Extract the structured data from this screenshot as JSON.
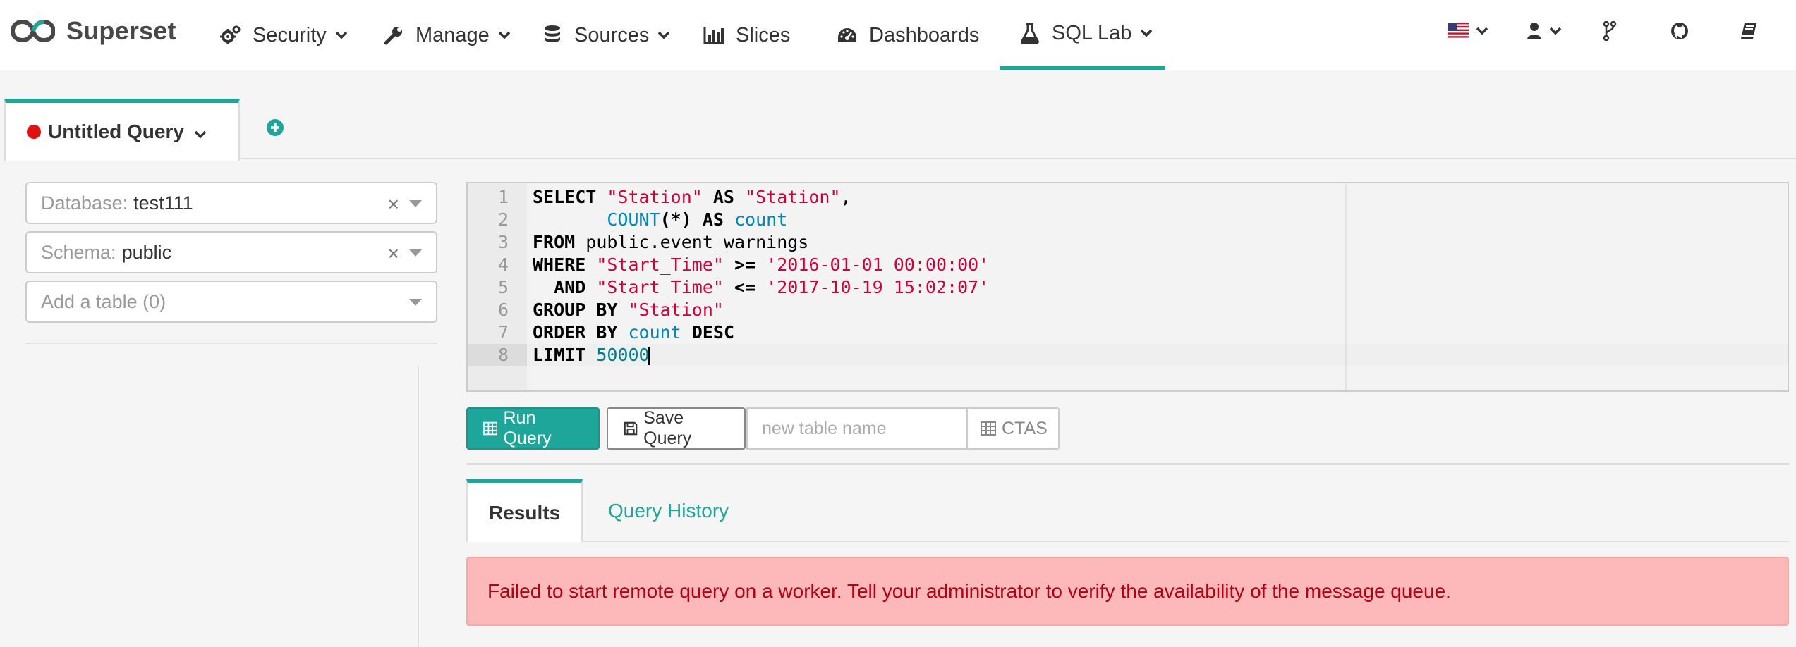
{
  "navbar": {
    "brand": "Superset",
    "items": [
      {
        "label": "Security",
        "icon": "cogs-icon",
        "dropdown": true
      },
      {
        "label": "Manage",
        "icon": "wrench-icon",
        "dropdown": true
      },
      {
        "label": "Sources",
        "icon": "database-icon",
        "dropdown": true
      },
      {
        "label": "Slices",
        "icon": "bar-chart-icon",
        "dropdown": false
      },
      {
        "label": "Dashboards",
        "icon": "dashboard-icon",
        "dropdown": false
      },
      {
        "label": "SQL Lab",
        "icon": "flask-icon",
        "dropdown": true,
        "active": true
      }
    ],
    "right_icons": [
      "us-flag-icon",
      "user-icon",
      "code-fork-icon",
      "github-icon",
      "book-icon"
    ]
  },
  "query_tabs": {
    "active_title": "Untitled Query",
    "status_color": "#e11111"
  },
  "left_panel": {
    "database": {
      "label": "Database:",
      "value": "test111"
    },
    "schema": {
      "label": "Schema:",
      "value": "public"
    },
    "table": {
      "placeholder": "Add a table (0)"
    }
  },
  "editor": {
    "lines": [
      {
        "n": "1",
        "tokens": [
          [
            "kw",
            "SELECT "
          ],
          [
            "str",
            "\"Station\""
          ],
          [
            "kw",
            " AS "
          ],
          [
            "str",
            "\"Station\""
          ],
          [
            "plain",
            ","
          ]
        ]
      },
      {
        "n": "2",
        "tokens": [
          [
            "plain",
            "       "
          ],
          [
            "fn",
            "COUNT"
          ],
          [
            "kw",
            "(*)"
          ],
          [
            "kw",
            " AS "
          ],
          [
            "fn",
            "count"
          ]
        ]
      },
      {
        "n": "3",
        "tokens": [
          [
            "kw",
            "FROM "
          ],
          [
            "plain",
            "public.event_warnings"
          ]
        ]
      },
      {
        "n": "4",
        "tokens": [
          [
            "kw",
            "WHERE "
          ],
          [
            "str",
            "\"Start_Time\""
          ],
          [
            "kw",
            " >= "
          ],
          [
            "str",
            "'2016-01-01 00:00:00'"
          ]
        ]
      },
      {
        "n": "5",
        "tokens": [
          [
            "kw",
            "  AND "
          ],
          [
            "str",
            "\"Start_Time\""
          ],
          [
            "kw",
            " <= "
          ],
          [
            "str",
            "'2017-10-19 15:02:07'"
          ]
        ]
      },
      {
        "n": "6",
        "tokens": [
          [
            "kw",
            "GROUP BY "
          ],
          [
            "str",
            "\"Station\""
          ]
        ]
      },
      {
        "n": "7",
        "tokens": [
          [
            "kw",
            "ORDER BY "
          ],
          [
            "fn",
            "count"
          ],
          [
            "kw",
            " DESC"
          ]
        ]
      },
      {
        "n": "8",
        "tokens": [
          [
            "kw",
            "LIMIT "
          ],
          [
            "num",
            "50000"
          ]
        ]
      }
    ]
  },
  "toolbar": {
    "run_label": "Run Query",
    "save_label": "Save Query",
    "table_name_placeholder": "new table name",
    "ctas_label": "CTAS"
  },
  "result_tabs": {
    "results": "Results",
    "history": "Query History"
  },
  "alert": {
    "message": "Failed to start remote query on a worker. Tell your administrator to verify the availability of the message queue."
  },
  "colors": {
    "accent": "#1fa69a",
    "danger_bg": "#fdb9b9",
    "danger_text": "#b30014"
  }
}
